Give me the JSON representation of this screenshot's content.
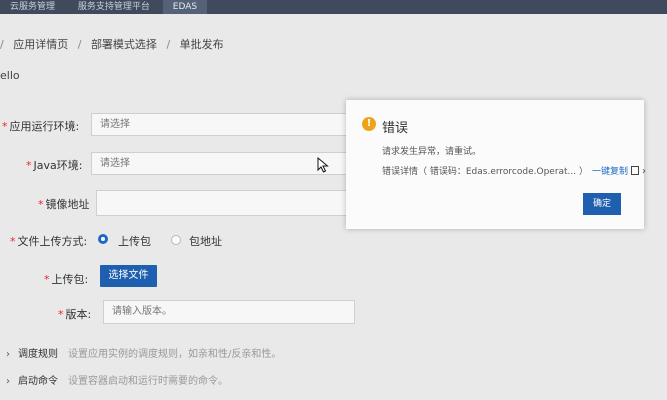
{
  "tabs": [
    "云服务管理",
    "服务支持管理平台",
    "EDAS"
  ],
  "breadcrumb": [
    "应用详情页",
    "部署模式选择",
    "单批发布"
  ],
  "app_title": "ello",
  "form": {
    "runtime_env_label": "应用运行环境:",
    "runtime_env_placeholder": "请选择",
    "java_env_label": "Java环境:",
    "java_env_placeholder": "请选择",
    "image_addr_label": "镜像地址",
    "upload_method_label": "文件上传方式:",
    "upload_option_1": "上传包",
    "upload_option_2": "包地址",
    "upload_pkg_label": "上传包:",
    "choose_file_button": "选择文件",
    "version_label": "版本:",
    "version_placeholder": "请输入版本。"
  },
  "sections": [
    {
      "title": "调度规则",
      "desc": "设置应用实例的调度规则，如亲和性/反亲和性。"
    },
    {
      "title": "启动命令",
      "desc": "设置容器启动和运行时需要的命令。"
    }
  ],
  "dialog": {
    "title": "错误",
    "message": "请求发生异常，请重试。",
    "detail": "错误详情（ 错误码：Edas.errorcode.Operat...  ）",
    "copy_link": "一键复制",
    "ok_button": "确定"
  },
  "colors": {
    "primary": "#1f5fb0",
    "warning": "#f0a21b",
    "required": "#e22233"
  }
}
